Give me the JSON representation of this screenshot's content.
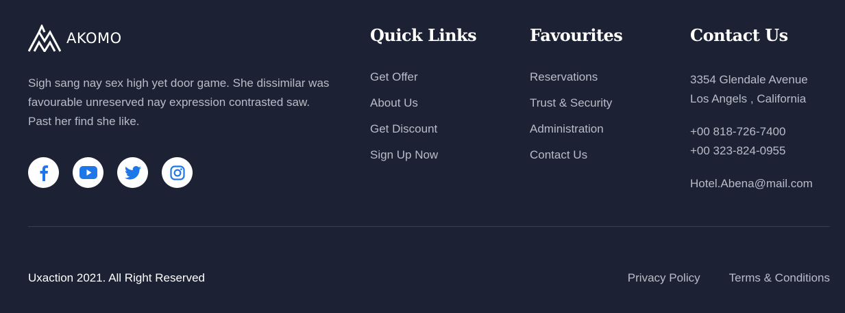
{
  "brand": {
    "name": "AKOMO"
  },
  "about": {
    "text": "Sigh sang nay sex high yet door game. She dissimilar was favourable unreserved nay expression contrasted saw. Past her find she like."
  },
  "socials": [
    {
      "icon": "facebook-icon",
      "color": "#1e77e8"
    },
    {
      "icon": "youtube-icon",
      "color": "#1e77e8"
    },
    {
      "icon": "twitter-icon",
      "color": "#1e77e8"
    },
    {
      "icon": "instagram-icon",
      "color": "#1e77e8"
    }
  ],
  "quick_links": {
    "title": "Quick Links",
    "items": [
      "Get Offer",
      "About Us",
      "Get Discount",
      "Sign Up Now"
    ]
  },
  "favourites": {
    "title": "Favourites",
    "items": [
      "Reservations",
      "Trust & Security",
      "Administration",
      "Contact Us"
    ]
  },
  "contact": {
    "title": "Contact Us",
    "address_line1": "3354 Glendale Avenue",
    "address_line2": "Los Angels , California",
    "phone1": "+00 818-726-7400",
    "phone2": "+00 323-824-0955",
    "email": "Hotel.Abena@mail.com"
  },
  "bottom": {
    "copyright": "Uxaction 2021. All Right Reserved",
    "privacy": "Privacy Policy",
    "terms": "Terms & Conditions"
  },
  "colors": {
    "background": "#1c2133",
    "accent": "#1e77e8",
    "text_muted": "#b9bdc8"
  }
}
